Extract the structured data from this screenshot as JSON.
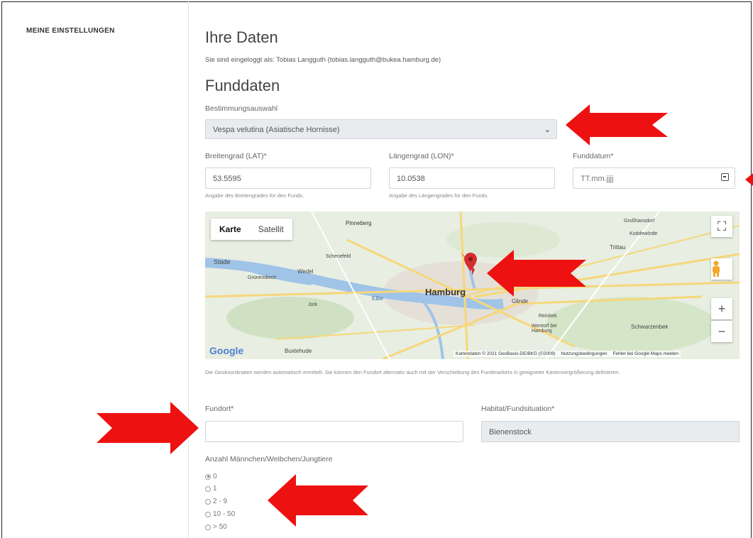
{
  "sidebar": {
    "heading": "MEINE EINSTELLUNGEN"
  },
  "profile": {
    "title": "Ihre Daten",
    "logged_in_text": "Sie sind eingeloggt als: Tobias Langguth (tobias.langguth@bukea.hamburg.de)"
  },
  "finding": {
    "title": "Funddaten",
    "species_label": "Bestimmungsauswahl",
    "species_value": "Vespa velutina (Asiatische Hornisse)",
    "lat_label": "Breitengrad (LAT)*",
    "lat_value": "53.5595",
    "lat_hint": "Angabe des Breitengrades für den Funds.",
    "lon_label": "Längengrad (LON)*",
    "lon_value": "10.0538",
    "lon_hint": "Angabe des Längengrades für den Funds.",
    "date_label": "Funddatum*",
    "date_placeholder": "TT.mm.jjjj",
    "geo_note": "Die Geokoordinaten werden automatisch ermittelt. Sie können den Fundort alternativ auch mit der Verschiebung des Fundmarkers in geeigneter Kartenvergrößerung definieren.",
    "location_label": "Fundort*",
    "location_value": "",
    "habitat_label": "Habitat/Fundsituation*",
    "habitat_value": "Bienenstock",
    "count_label": "Anzahl Männchen/Weibchen/Jungtiere",
    "count_options": [
      "0",
      "1",
      "2 - 9",
      "10 - 50",
      "> 50"
    ],
    "count_selected": "0"
  },
  "map": {
    "type_map": "Karte",
    "type_satellite": "Satellit",
    "city_label": "Hamburg",
    "places": [
      "Pinneberg",
      "Stade",
      "Wedel",
      "Schenefeld",
      "Grünendeich",
      "Jork",
      "Elbe",
      "Buxtehude",
      "Glinde",
      "Reinbek",
      "Wentorf bei Hamburg",
      "Schwarzenbek",
      "Großhansdorf",
      "Trittau",
      "Kuddewörde"
    ],
    "attribution": "Kartendaten © 2021 GeoBasis-DE/BKG (©2009)",
    "terms": "Nutzungsbedingungen",
    "report": "Fehler bei Google Maps melden",
    "logo": "Google",
    "colors": {
      "water": "#9fc4e8",
      "land": "#e8eee1",
      "road": "#f6d77a",
      "marker": "#d32f2f"
    }
  },
  "annotation": {
    "arrow_color": "#ee1111"
  }
}
